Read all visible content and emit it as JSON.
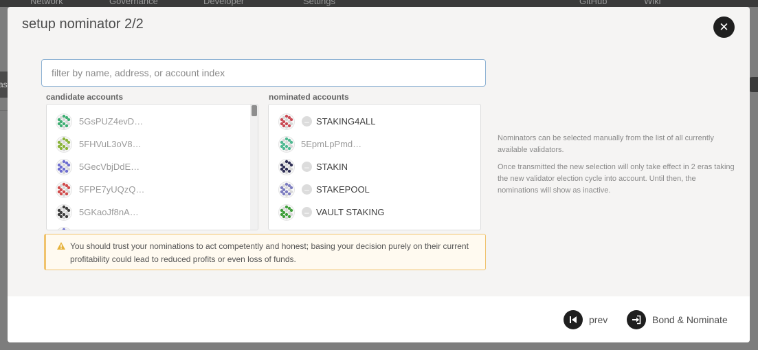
{
  "background": {
    "nav": [
      "Network",
      "Governance",
      "Developer",
      "Settings",
      "GitHub",
      "Wiki"
    ],
    "side_fragment": "as"
  },
  "modal": {
    "title": "setup nominator 2/2",
    "close_icon": "close-icon",
    "filter_placeholder": "filter by name, address, or account index",
    "candidate_label": "candidate accounts",
    "nominated_label": "nominated accounts",
    "candidates": [
      {
        "address": "5GsPUZ4evD…",
        "icon_color": "#3fae73"
      },
      {
        "address": "5FHVuL3oV8…",
        "icon_color": "#8ab33a"
      },
      {
        "address": "5GecVbjDdE…",
        "icon_color": "#6d6dcf"
      },
      {
        "address": "5FPE7yUQzQ…",
        "icon_color": "#d04b4b"
      },
      {
        "address": "5GKaoJf8nA…",
        "icon_color": "#3d3d3d"
      }
    ],
    "nominated": [
      {
        "name": "STAKING4ALL",
        "address": "",
        "icon_color": "#c94a54",
        "has_name": true
      },
      {
        "name": "",
        "address": "5EpmLpPmd…",
        "icon_color": "#4fb891",
        "has_name": false
      },
      {
        "name": "STAKIN",
        "address": "",
        "icon_color": "#2f2f55",
        "has_name": true
      },
      {
        "name": "STAKEPOOL",
        "address": "",
        "icon_color": "#7c7cc0",
        "has_name": true
      },
      {
        "name": "VAULT STAKING",
        "address": "",
        "icon_color": "#3f9e3a",
        "has_name": true
      }
    ],
    "warning": "You should trust your nominations to act competently and honest; basing your decision purely on their current profitability could lead to reduced profits or even loss of funds.",
    "help": [
      "Nominators can be selected manually from the list of all currently available validators.",
      "Once transmitted the new selection will only take effect in 2 eras taking the new validator election cycle into account. Until then, the nominations will show as inactive."
    ],
    "buttons": {
      "prev": "prev",
      "bond": "Bond & Nominate"
    },
    "colors": {
      "accent_dark": "#1f1f1f",
      "warning_border": "#f0c36d",
      "input_border": "#8fb3d4"
    }
  }
}
